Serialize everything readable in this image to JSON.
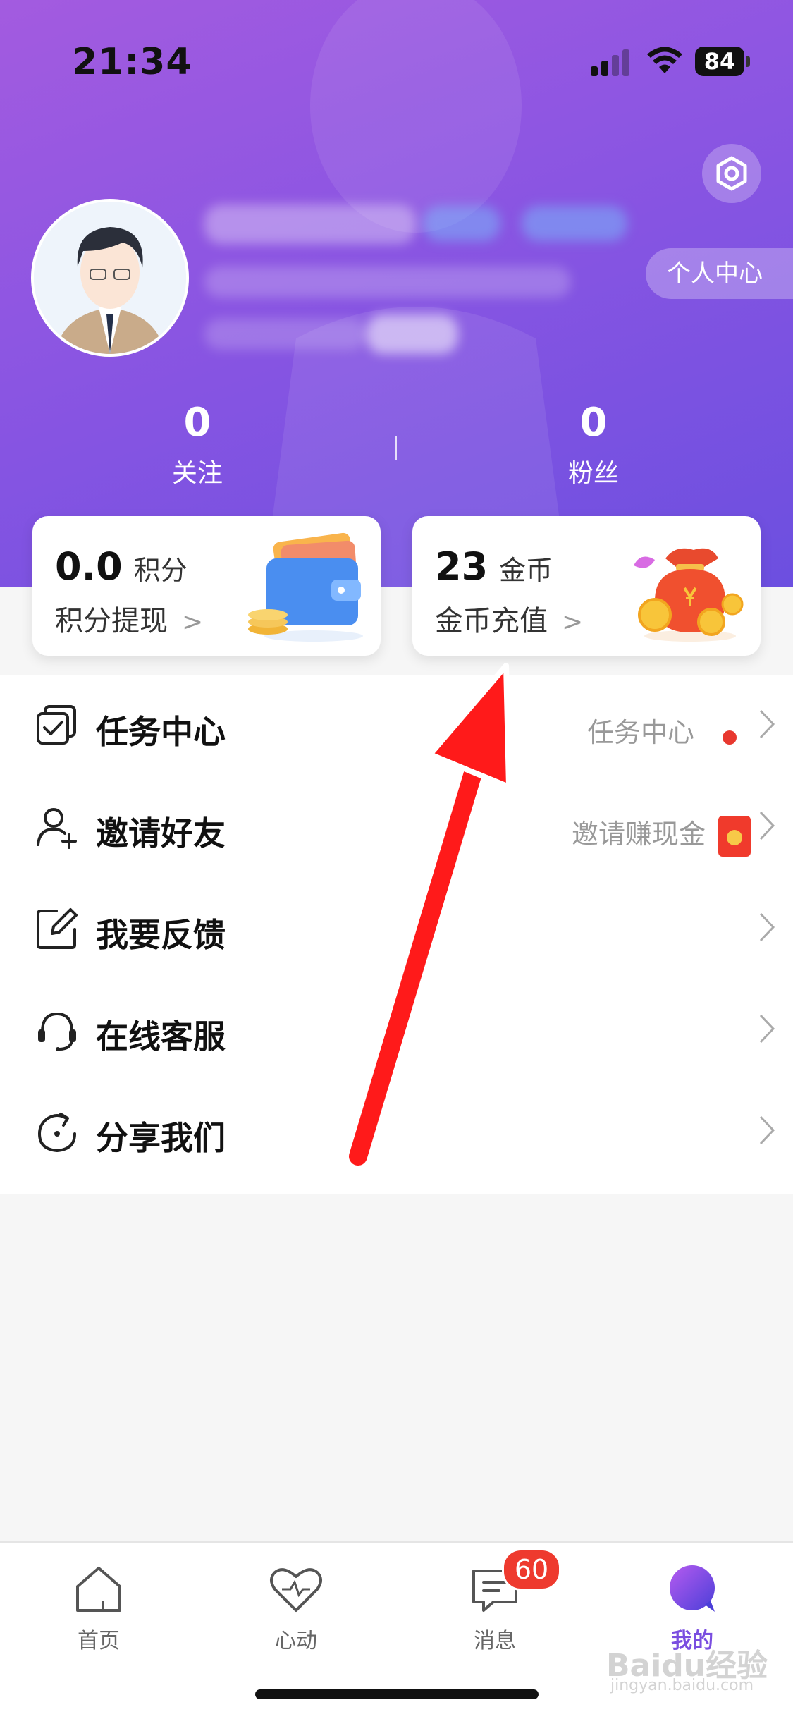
{
  "status_bar": {
    "time": "21:34",
    "battery": "84"
  },
  "profile": {
    "personal_center": "个人中心"
  },
  "stats": [
    {
      "value": "0",
      "label": "关注"
    },
    {
      "value": "0",
      "label": "粉丝"
    }
  ],
  "cards": {
    "points": {
      "value": "0.0",
      "unit": "积分",
      "action": "积分提现"
    },
    "coins": {
      "value": "23",
      "unit": "金币",
      "action": "金币充值"
    }
  },
  "menu": [
    {
      "label": "任务中心",
      "right": "任务中心",
      "icon": "task-checklist-icon"
    },
    {
      "label": "邀请好友",
      "right": "邀请赚现金",
      "icon": "add-user-icon"
    },
    {
      "label": "我要反馈",
      "right": "",
      "icon": "edit-feedback-icon"
    },
    {
      "label": "在线客服",
      "right": "",
      "icon": "headset-icon"
    },
    {
      "label": "分享我们",
      "right": "",
      "icon": "share-refresh-icon"
    }
  ],
  "tabs": [
    {
      "label": "首页",
      "icon": "home-icon"
    },
    {
      "label": "心动",
      "icon": "heartbeat-icon"
    },
    {
      "label": "消息",
      "icon": "message-icon",
      "badge": "60"
    },
    {
      "label": "我的",
      "icon": "profile-bubble-icon",
      "active": true
    }
  ],
  "watermark": {
    "brand": "Baidu经验",
    "url": "jingyan.baidu.com"
  },
  "colors": {
    "accent": "#7a4ee0",
    "header_start": "#a35be0",
    "header_end": "#6c4fe0",
    "badge": "#ee3a2e",
    "arrow": "#ff1a1a"
  }
}
